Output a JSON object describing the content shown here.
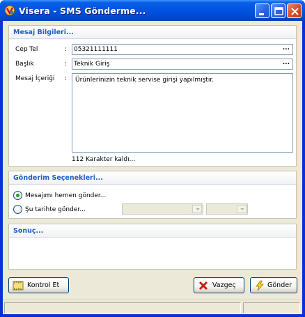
{
  "window": {
    "title": "Visera - SMS Gönderme..."
  },
  "mesaj": {
    "title": "Mesaj Bilgileri...",
    "cep_label": "Cep Tel",
    "cep_value": "05321111111",
    "baslik_label": "Başlık",
    "baslik_value": "Teknik Giriş",
    "icerik_label": "Mesaj İçeriği",
    "icerik_value": "Ürünlerinizin teknik servise girişi yapılmıştır.",
    "remaining": "112 Karakter kaldı...",
    "colon": ":",
    "ellipsis": "..."
  },
  "gonderim": {
    "title": "Gönderim Seçenekleri...",
    "option_now": "Mesajımı hemen gönder...",
    "option_date": "Şu tarihte gönder...",
    "selected": "option_now"
  },
  "sonuc": {
    "title": "Sonuç...",
    "text": ""
  },
  "buttons": {
    "kontrol": "Kontrol Et",
    "vazgec": "Vazgeç",
    "gonder": "Gönder"
  },
  "icons": {
    "app": "visera-app-icon",
    "kontrol": "ruler-icon",
    "vazgec": "red-x-icon",
    "gonder": "lightning-icon"
  },
  "colors": {
    "title_blue": "#0054e3",
    "group_title": "#215dc6",
    "radio_dot": "#21a121",
    "client_bg": "#ece9d8"
  }
}
